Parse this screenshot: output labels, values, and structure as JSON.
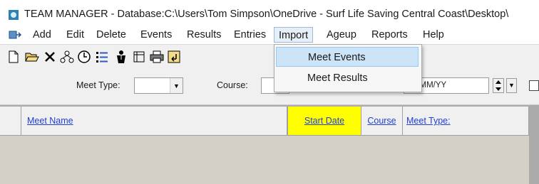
{
  "title": "TEAM MANAGER - Database:C:\\Users\\Tom Simpson\\OneDrive - Surf Life Saving Central Coast\\Desktop\\",
  "menu": {
    "items": [
      "Add",
      "Edit",
      "Delete",
      "Events",
      "Results",
      "Entries",
      "Import",
      "Ageup",
      "Reports",
      "Help"
    ],
    "active": "Import"
  },
  "import_menu": {
    "items": [
      "Meet Events",
      "Meet Results"
    ],
    "highlighted": "Meet Events"
  },
  "filters": {
    "meet_type_label": "Meet Type:",
    "course_label": "Course:",
    "date_placeholder": "D/MM/YY"
  },
  "grid": {
    "columns": [
      "Meet Name",
      "Start Date",
      "Course",
      "Meet Type:"
    ],
    "highlight_color": "#ffff00"
  },
  "icons": [
    "new-icon",
    "open-icon",
    "delete-icon",
    "structure-icon",
    "clock-icon",
    "list-icon",
    "person-icon",
    "calendar-icon",
    "print-icon",
    "back-icon"
  ]
}
